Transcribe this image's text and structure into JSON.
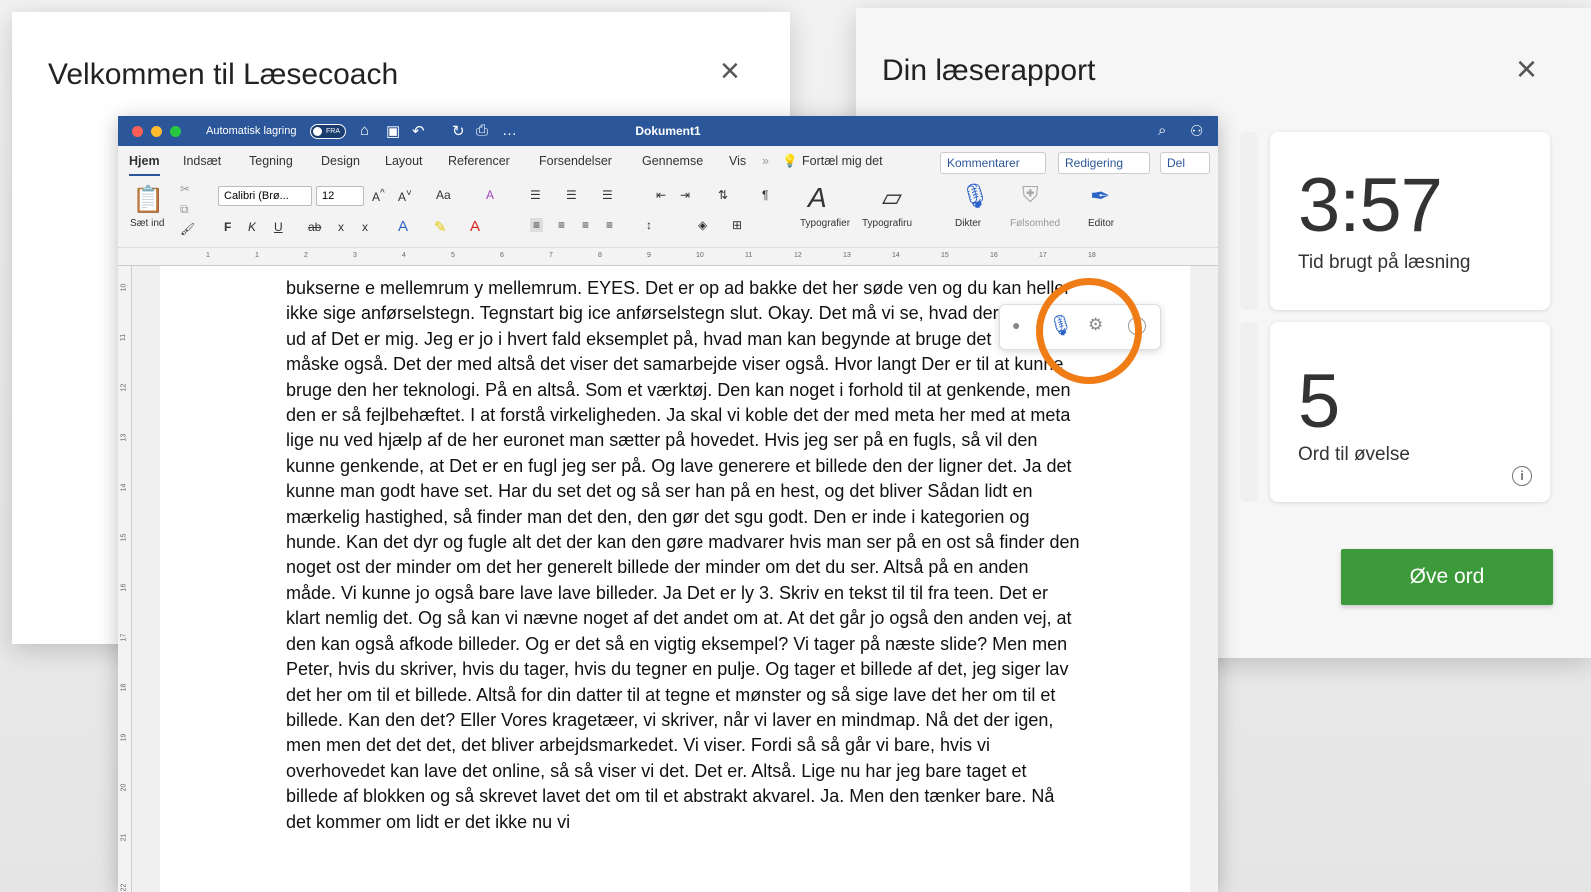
{
  "coach_panel": {
    "title": "Velkommen til Læsecoach",
    "close": "×"
  },
  "report_panel": {
    "title": "Din læserapport",
    "close": "×",
    "time_value": "3:57",
    "time_label": "Tid brugt på læsning",
    "words_value": "5",
    "words_label": "Ord til øvelse",
    "info_icon": "i",
    "practice_button": "Øve ord"
  },
  "word": {
    "autosave_label": "Automatisk lagring",
    "autosave_state": "FRA",
    "doc_title": "Dokument1",
    "tabs": [
      "Hjem",
      "Indsæt",
      "Tegning",
      "Design",
      "Layout",
      "Referencer",
      "Forsendelser",
      "Gennemse",
      "Vis"
    ],
    "more_tabs": "»",
    "tellme": "Fortæl mig det",
    "comments": "Kommentarer",
    "editing": "Redigering",
    "share": "Del",
    "ribbon": {
      "paste": "Sæt ind",
      "font": "Calibri (Brø...",
      "size": "12",
      "styles": "Typografier",
      "styles_pane": "Typografiru",
      "dictate": "Dikter",
      "sensitivity": "Følsomhed",
      "editor": "Editor",
      "bold": "F",
      "italic": "K",
      "underline": "U",
      "strike": "ab",
      "subscript": "x",
      "superscript": "x"
    },
    "ruler_marks": [
      "1",
      "1",
      "2",
      "3",
      "4",
      "5",
      "6",
      "7",
      "8",
      "9",
      "10",
      "11",
      "12",
      "13",
      "14",
      "15",
      "16",
      "17",
      "18"
    ],
    "vruler_marks": [
      "10",
      "11",
      "12",
      "13",
      "14",
      "15",
      "16",
      "17",
      "18",
      "19",
      "20",
      "21",
      "22"
    ]
  },
  "document": {
    "lines": [
      "bukserne e mellemrum y mellemrum. EYES. Det er op ad bakke det her søde ven og du kan heller",
      "ikke sige anførselstegn. Tegnstart big ice anførselstegn slut. Okay. Det må vi se, hvad der kommer",
      "ud af Det er mig. Jeg er jo i hvert fald eksemplet på, hvad man kan begynde at bruge det",
      "måske også. Det der med altså det viser det samarbejde viser også. Hvor langt Der er til at kunne",
      "bruge den her teknologi. På en altså. Som et værktøj. Den kan noget i forhold til at genkende, men",
      "den er så fejlbehæftet. I at forstå virkeligheden. Ja skal vi koble det der med meta her med at meta",
      "lige nu ved hjælp af de her euronet man sætter på hovedet. Hvis jeg ser på en fugls, så vil den",
      "kunne genkende, at Det er en fugl jeg ser på. Og lave generere et billede den der ligner det. Ja det",
      "kunne man godt have set. Har du set det og så ser han på en hest, og det bliver Sådan lidt en",
      "mærkelig hastighed, så finder man det den, den gør det sgu godt. Den er inde i kategorien og",
      "hunde. Kan det dyr og fugle alt det der kan den gøre madvarer hvis man ser på en ost så finder den",
      "noget ost der minder om det her generelt billede der minder om det du ser. Altså på en anden",
      "måde. Vi kunne jo også bare lave lave billeder. Ja Det er ly 3. Skriv en tekst til til fra teen. Det er",
      "klart nemlig det. Og så kan vi nævne noget af det andet om at. At det går jo også den anden vej, at",
      "den kan også afkode billeder. Og er det så en vigtig eksempel? Vi tager på næste slide? Men men",
      "Peter, hvis du skriver, hvis du tager, hvis du tegner en pulje. Og tager et billede af det, jeg siger lav",
      "det her om til et billede. Altså for din datter til at tegne et mønster og så sige lave det her om til et",
      "billede. Kan den det? Eller Vores kragetæer, vi skriver, når vi laver en mindmap. Nå det der igen,",
      "men men det det det, det bliver arbejdsmarkedet. Vi viser. Fordi så så går vi bare, hvis vi",
      "overhovedet kan lave det online, så så viser vi det. Det er. Altså. Lige nu har jeg bare taget et",
      "billede af blokken og så skrevet lavet det om til et abstrakt akvarel. Ja. Men den tænker bare. Nå",
      "det kommer om lidt er det ikke nu vi"
    ]
  },
  "colors": {
    "titlebar": "#2b579a",
    "highlight_circle": "#f07c15",
    "practice_button": "#3c9a3a"
  }
}
